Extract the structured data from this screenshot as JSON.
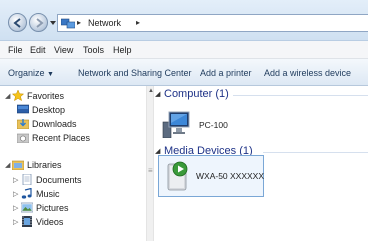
{
  "address_bar": {
    "location": "Network"
  },
  "menu": [
    "File",
    "Edit",
    "View",
    "Tools",
    "Help"
  ],
  "toolbar": {
    "organize": "Organize",
    "commands": [
      "Network and Sharing Center",
      "Add a printer",
      "Add a wireless device"
    ]
  },
  "nav": {
    "favorites": {
      "label": "Favorites",
      "items": [
        "Desktop",
        "Downloads",
        "Recent Places"
      ]
    },
    "libraries": {
      "label": "Libraries",
      "items": [
        "Documents",
        "Music",
        "Pictures",
        "Videos"
      ]
    }
  },
  "content": {
    "groups": [
      {
        "header": "Computer (1)",
        "items": [
          "PC-100"
        ]
      },
      {
        "header": "Media Devices (1)",
        "items": [
          "WXA-50 XXXXXX"
        ]
      }
    ]
  },
  "colors": {
    "group_header": "#1e3287",
    "selection_border": "#7aa7d6",
    "selection_fill": "#eef5fd"
  }
}
